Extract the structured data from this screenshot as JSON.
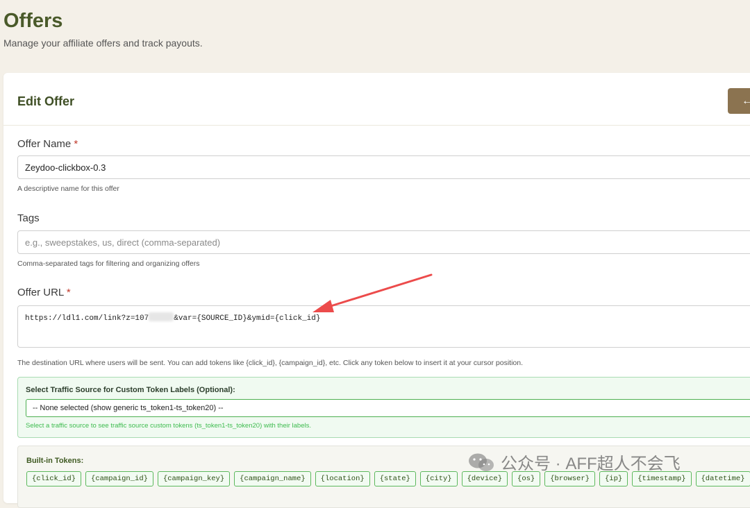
{
  "page": {
    "title": "Offers",
    "subtitle": "Manage your affiliate offers and track payouts."
  },
  "card": {
    "title": "Edit Offer",
    "back_label": "←"
  },
  "offer_name": {
    "label": "Offer Name",
    "required_mark": "*",
    "value": "Zeydoo-clickbox-0.3",
    "help": "A descriptive name for this offer"
  },
  "tags": {
    "label": "Tags",
    "placeholder": "e.g., sweepstakes, us, direct (comma-separated)",
    "help": "Comma-separated tags for filtering and organizing offers"
  },
  "offer_url": {
    "label": "Offer URL",
    "required_mark": "*",
    "value_prefix": "https://ldl1.com/link?z=107",
    "value_suffix": "&var={SOURCE_ID}&ymid={click_id}",
    "help": "The destination URL where users will be sent. You can add tokens like {click_id}, {campaign_id}, etc. Click any token below to insert it at your cursor position."
  },
  "traffic_source": {
    "label": "Select Traffic Source for Custom Token Labels (Optional):",
    "selected": "-- None selected (show generic ts_token1-ts_token20) --",
    "help": "Select a traffic source to see traffic source custom tokens (ts_token1-ts_token20) with their labels."
  },
  "builtin_tokens": {
    "label": "Built-in Tokens:",
    "items": [
      "{click_id}",
      "{campaign_id}",
      "{campaign_key}",
      "{campaign_name}",
      "{location}",
      "{state}",
      "{city}",
      "{device}",
      "{os}",
      "{browser}",
      "{ip}",
      "{timestamp}",
      "{datetime}"
    ]
  },
  "watermark": {
    "text": "公众号 · AFF超人不会飞"
  },
  "colors": {
    "title_green": "#4a5a2a",
    "back_button": "#8b7350",
    "token_border": "#5cb85c",
    "annotation_arrow": "#ec4b4b"
  }
}
